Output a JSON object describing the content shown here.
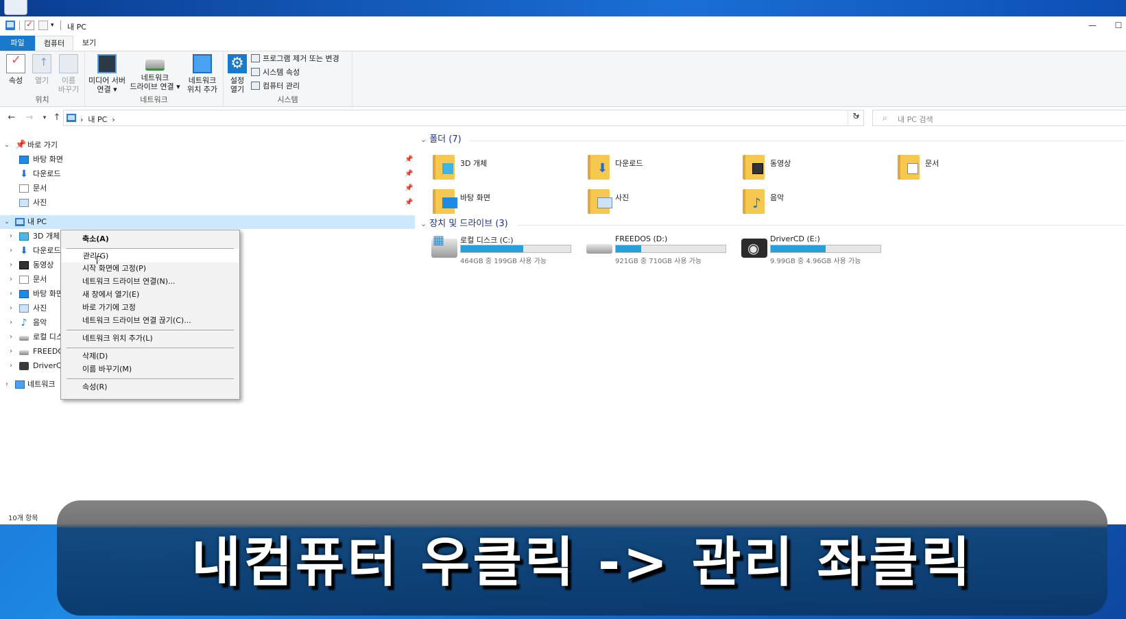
{
  "window": {
    "title": "내 PC",
    "minimize_glyph": "—",
    "maximize_glyph": "☐"
  },
  "ribbon": {
    "tabs": [
      "파일",
      "컴퓨터",
      "보기"
    ],
    "groups": {
      "location": {
        "label": "위치",
        "buttons": [
          {
            "label_line1": "속성",
            "label_line2": ""
          },
          {
            "label_line1": "열기",
            "label_line2": ""
          },
          {
            "label_line1": "이름",
            "label_line2": "바꾸기"
          }
        ]
      },
      "network": {
        "label": "네트워크",
        "buttons": [
          {
            "label_line1": "미디어 서버",
            "label_line2": "연결 ▾"
          },
          {
            "label_line1": "네트워크",
            "label_line2": "드라이브 연결 ▾"
          },
          {
            "label_line1": "네트워크",
            "label_line2": "위치 추가"
          }
        ]
      },
      "system": {
        "label": "시스템",
        "settings_line1": "설정",
        "settings_line2": "열기",
        "items": [
          "프로그램 제거 또는 변경",
          "시스템 속성",
          "컴퓨터 관리"
        ]
      }
    }
  },
  "address": {
    "path": "내 PC",
    "path_sep": "›",
    "search_placeholder": "내 PC 검색"
  },
  "nav": {
    "quick_access": "바로 가기",
    "quick_items": [
      "바탕 화면",
      "다운로드",
      "문서",
      "사진"
    ],
    "this_pc": "내 PC",
    "pc_items": [
      "3D 개체",
      "다운로드",
      "동영상",
      "문서",
      "바탕 화면",
      "사진",
      "음악",
      "로컬 디스크",
      "FREEDOS",
      "DriverCD"
    ],
    "network": "네트워크"
  },
  "content": {
    "folders_header": "폴더 (7)",
    "folders": [
      "3D 개체",
      "다운로드",
      "동영상",
      "문서",
      "바탕 화면",
      "사진",
      "음악"
    ],
    "devices_header": "장치 및 드라이브 (3)",
    "drives": [
      {
        "name": "로컬 디스크 (C:)",
        "free": "464GB 중 199GB 사용 가능",
        "used_fraction": 0.57
      },
      {
        "name": "FREEDOS (D:)",
        "free": "921GB 중 710GB 사용 가능",
        "used_fraction": 0.23
      },
      {
        "name": "DriverCD (E:)",
        "free": "9.99GB 중 4.96GB 사용 가능",
        "used_fraction": 0.5
      }
    ]
  },
  "status": {
    "items_count": "10개 항목"
  },
  "context_menu": {
    "items": [
      "축소(A)",
      "관리(G)",
      "시작 화면에 고정(P)",
      "네트워크 드라이브 연결(N)...",
      "새 창에서 열기(E)",
      "바로 가기에 고정",
      "네트워크 드라이브 연결 끊기(C)...",
      "네트워크 위치 추가(L)",
      "삭제(D)",
      "이름 바꾸기(M)",
      "속성(R)"
    ]
  },
  "caption": {
    "text": "내컴퓨터 우클릭 -> 관리 좌클릭"
  },
  "colors": {
    "accent": "#1979ca",
    "selection": "#cce8ff",
    "drive_fill": "#26a0da",
    "section_header": "#1e3287"
  }
}
